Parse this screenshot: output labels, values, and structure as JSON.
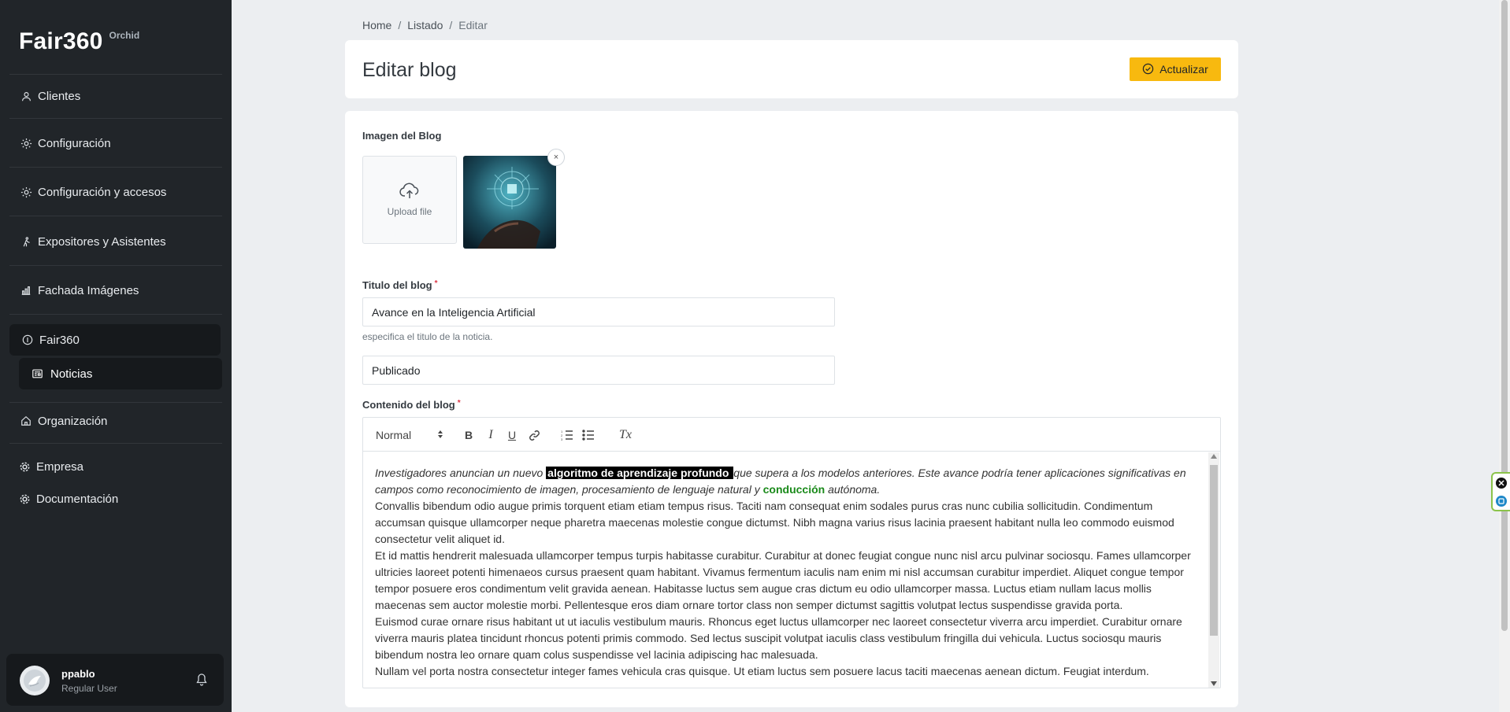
{
  "sidebar": {
    "brand": "Fair360",
    "brand_sub": "Orchid",
    "items": [
      {
        "label": "Clientes",
        "icon": "person-icon"
      },
      {
        "label": "Configuración",
        "icon": "gear-icon"
      },
      {
        "label": "Configuración y accesos",
        "icon": "gear-icon"
      },
      {
        "label": "Expositores y Asistentes",
        "icon": "walking-icon"
      },
      {
        "label": "Fachada Imágenes",
        "icon": "bar-chart-icon"
      },
      {
        "label": "Fair360",
        "icon": "circle-icon"
      },
      {
        "label": "Noticias",
        "icon": "newspaper-icon"
      },
      {
        "label": "Organización",
        "icon": "home-icon"
      },
      {
        "label": "Empresa",
        "icon": "cog-icon"
      },
      {
        "label": "Documentación",
        "icon": "cog-icon"
      }
    ]
  },
  "user": {
    "name": "ppablo",
    "role": "Regular User"
  },
  "breadcrumb": {
    "home": "Home",
    "list": "Listado",
    "current": "Editar",
    "sep": "/"
  },
  "header": {
    "title": "Editar blog",
    "update_label": "Actualizar"
  },
  "form": {
    "image_label": "Imagen del Blog",
    "upload_label": "Upload file",
    "close_symbol": "×",
    "title_label": "Titulo del blog",
    "required_mark": "*",
    "title_value": "Avance en la Inteligencia Artificial",
    "title_help": "especifica el titulo de la noticia.",
    "status_value": "Publicado",
    "content_label": "Contenido del blog"
  },
  "editor": {
    "format_value": "Normal",
    "bold": "B",
    "italic": "I",
    "underline": "U",
    "clear": "Tx",
    "p1_a": "Investigadores anuncian un nuevo ",
    "p1_hl": "algoritmo de aprendizaje profundo ",
    "p1_b": "que supera a los modelos anteriores. Este avance podría tener aplicaciones significativas en campos como reconocimiento de imagen, procesamiento de lenguaje natural y ",
    "p1_green": "conducción",
    "p1_c": " autónoma.",
    "p2": "Convallis bibendum odio augue primis torquent etiam etiam tempus risus. Taciti nam consequat enim sodales purus cras nunc cubilia sollicitudin. Condimentum accumsan quisque ullamcorper neque pharetra maecenas molestie congue dictumst. Nibh magna varius risus lacinia praesent habitant nulla leo commodo euismod consectetur velit aliquet id.",
    "p3": "Et id mattis hendrerit malesuada ullamcorper tempus turpis habitasse curabitur. Curabitur at donec feugiat congue nunc nisl arcu pulvinar sociosqu. Fames ullamcorper ultricies laoreet potenti himenaeos cursus praesent quam habitant. Vivamus fermentum iaculis nam enim mi nisl accumsan curabitur imperdiet. Aliquet congue tempor tempor posuere eros condimentum velit gravida aenean. Habitasse luctus sem augue cras dictum eu odio ullamcorper massa. Luctus etiam nullam lacus mollis maecenas sem auctor molestie morbi. Pellentesque eros diam ornare tortor class non semper dictumst sagittis volutpat lectus suspendisse gravida porta.",
    "p4": "Euismod curae ornare risus habitant ut ut iaculis vestibulum mauris. Rhoncus eget luctus ullamcorper nec laoreet consectetur viverra arcu imperdiet. Curabitur ornare viverra mauris platea tincidunt rhoncus potenti primis commodo. Sed lectus suscipit volutpat iaculis class vestibulum fringilla dui vehicula. Luctus sociosqu mauris bibendum nostra leo ornare quam colus suspendisse vel lacinia adipiscing hac malesuada.",
    "p5": "Nullam vel porta nostra consectetur integer fames vehicula cras quisque. Ut etiam luctus sem posuere lacus taciti maecenas aenean dictum. Feugiat interdum."
  },
  "colors": {
    "sidebar": "#212529",
    "accent": "#f8b90f",
    "highlight": "#000000",
    "green_text": "#1a8a1a",
    "required": "#dc3545"
  }
}
